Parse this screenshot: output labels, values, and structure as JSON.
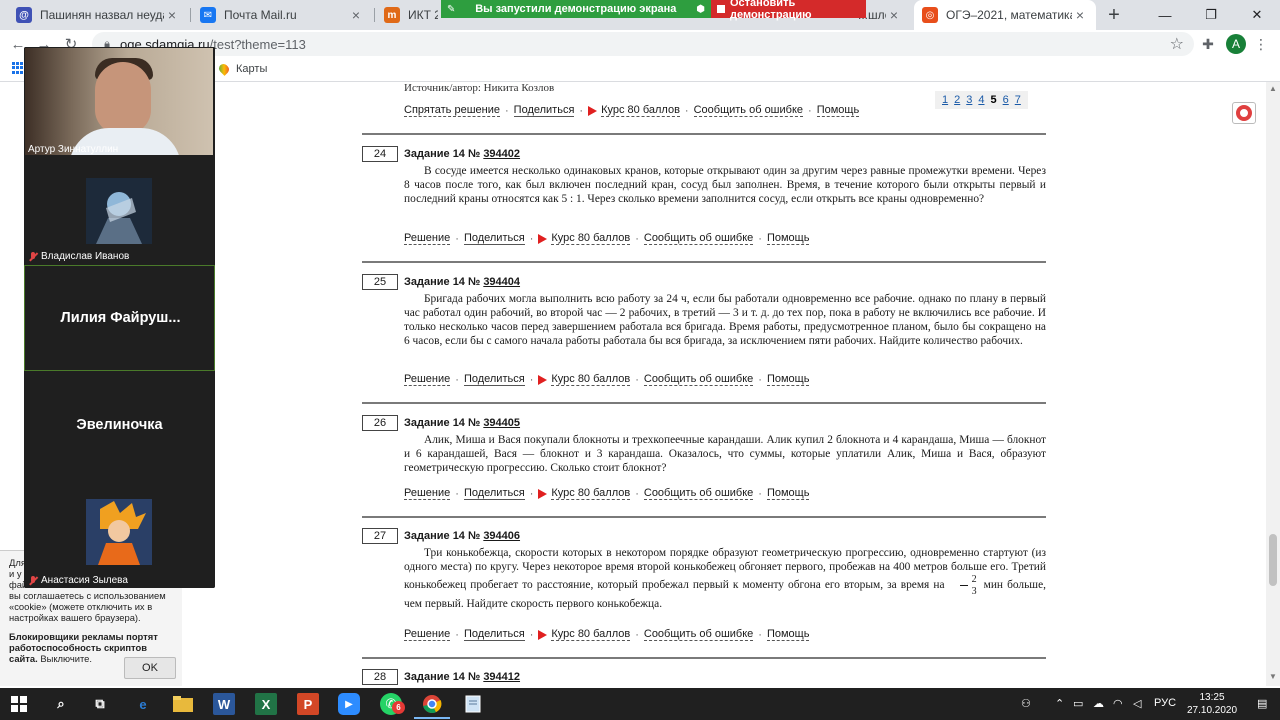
{
  "browser": {
    "tabs": [
      {
        "title": "Пашинян назвал неудачей ...",
        "favicon_color": "#3f51b5",
        "favicon_glyph": "@"
      },
      {
        "title": "Почта Mail.ru",
        "favicon_color": "#1877f2",
        "favicon_glyph": "✉"
      },
      {
        "title": "ИКТ 2 по...",
        "favicon_color": "#e06a18",
        "favicon_glyph": "m"
      },
      {
        "title": "...шло",
        "favicon_color": "#9aa0a6",
        "favicon_glyph": ""
      },
      {
        "title": "ОГЭ–2021, математика: зад...",
        "favicon_color": "#e84e1b",
        "favicon_glyph": "◎"
      }
    ],
    "new_tab_label": "+",
    "window_controls": {
      "minimize": "—",
      "maximize": "❐",
      "close": "✕"
    },
    "demo": {
      "running_label": "Вы запустили демонстрацию экрана",
      "stop_label": "Остановить демонстрацию"
    },
    "address": {
      "host": "oge.sdamgia.ru",
      "path": "/test?theme=113"
    },
    "profile_initial": "A",
    "bookmarks": [
      {
        "label": "Карты"
      }
    ]
  },
  "video_panel": {
    "participants": [
      {
        "name": "Артур Зиннатуллин",
        "type": "camera",
        "muted": false
      },
      {
        "name": "Владислав Иванов",
        "type": "avatar",
        "muted": true
      },
      {
        "name": "Лилия Файруш...",
        "type": "name_only",
        "muted": false
      },
      {
        "name": "Эвелиночка",
        "type": "name_only",
        "muted": false
      },
      {
        "name": "Анастасия Зылева",
        "type": "avatar",
        "muted": true
      }
    ]
  },
  "page": {
    "source_line": "Источник/автор: Никита Козлов",
    "pager": {
      "pages": [
        "1",
        "2",
        "3",
        "4",
        "5",
        "6",
        "7"
      ],
      "current": "5"
    },
    "links": {
      "hide_solution": "Спрятать решение",
      "solution": "Решение",
      "share": "Поделиться",
      "course": "Курс 80 баллов",
      "report": "Сообщить об ошибке",
      "help": "Помощь"
    },
    "tasks": [
      {
        "num": "24",
        "title": "Задание 14 №",
        "id": "394402",
        "text": "В сосуде имеется несколько одинаковых кранов, которые открывают один за другим через равные промежутки времени. Через 8 часов после того, как был включен последний кран, сосуд был заполнен. Время, в течение которого были открыты первый и последний краны относятся как 5 : 1. Через сколько времени заполнится сосуд, если открыть все краны одновременно?"
      },
      {
        "num": "25",
        "title": "Задание 14 №",
        "id": "394404",
        "text": "Бригада рабочих могла выполнить всю работу за 24 ч, если бы работали одновременно все рабочие. однако по плану в первый час работал один рабочий, во второй час — 2 рабочих, в третий — 3 и т. д. до тех пор, пока в работу не включились все рабочие. И только несколько часов перед завершением работала вся бригада. Время работы, предусмотренное планом, было бы сокращено на 6 часов, если бы с самого начала работы работала бы вся бригада, за исключением пяти рабочих. Найдите количество рабочих."
      },
      {
        "num": "26",
        "title": "Задание 14 №",
        "id": "394405",
        "text": "Алик, Миша и Вася покупали блокноты и трехкопеечные карандаши. Алик купил 2 блокнота и 4 карандаша, Миша — блокнот и 6 карандашей, Вася — блокнот и 3 карандаша. Оказалось, что суммы, которые уплатили Алик, Миша и Вася, образуют геометрическую прогрессию. Сколько стоит блокнот?"
      },
      {
        "num": "27",
        "title": "Задание 14 №",
        "id": "394406",
        "text_before": "Три конькобежца, скорости которых в некотором порядке образуют геометрическую прогрессию, одновременно стартуют (из одного места) по кругу. Через некоторое время второй конькобежец обгоняет первого, пробежав на 400 метров больше его. Третий конькобежец пробегает то расстояние, который пробежал первый к моменту обгона его вторым, за время на",
        "frac_num": "2",
        "frac_den": "3",
        "text_after": "мин больше, чем первый. Найдите скорость первого конькобежца."
      },
      {
        "num": "28",
        "title": "Задание 14 №",
        "id": "394412"
      }
    ],
    "cookie": {
      "text_top": "Для ... и у... фай... вы соглашаетесь с использованием «cookie» (можете отключить их в настройках вашего браузера).",
      "line1": "Для",
      "line2": "и у",
      "line3": "фай",
      "line4": "вы соглашаетесь с использованием",
      "line5": "«cookie» (можете отключить их в",
      "line6": "настройках вашего браузера).",
      "warning": "Блокировщики рекламы портят работоспособность скриптов сайта.",
      "warning_action": "Выключите.",
      "ok_label": "OK"
    }
  },
  "taskbar": {
    "language": "РУС",
    "time": "13:25",
    "date": "27.10.2020",
    "whatsapp_badge": "6"
  },
  "colors": {
    "demo_green": "#2e9e3f",
    "demo_red": "#d42a2a",
    "course_play": "#e02020",
    "taskbar": "#202020"
  }
}
